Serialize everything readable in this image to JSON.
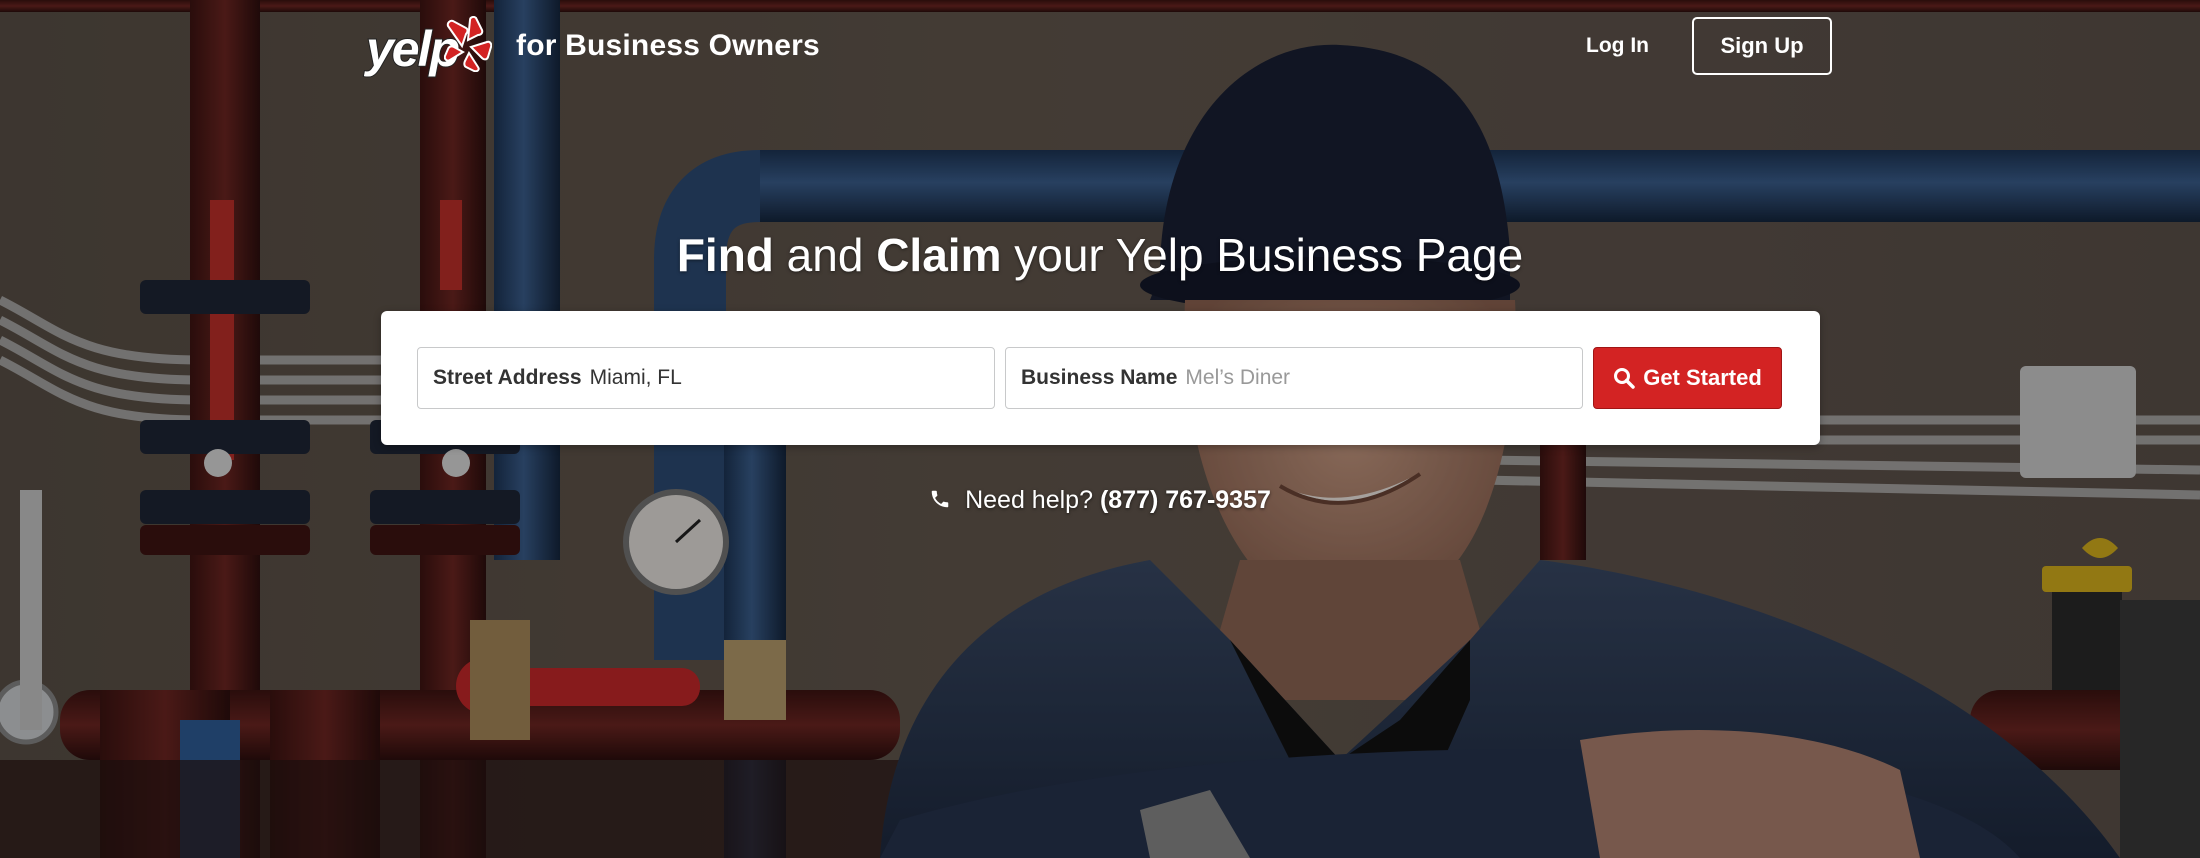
{
  "header": {
    "logo_text": "yelp",
    "tagline": "for Business Owners",
    "login_label": "Log In",
    "signup_label": "Sign Up"
  },
  "hero": {
    "headline_find": "Find",
    "headline_and": " and ",
    "headline_claim": "Claim",
    "headline_rest": " your Yelp Business Page"
  },
  "search": {
    "address_label": "Street Address",
    "address_value": "Miami, FL",
    "name_label": "Business Name",
    "name_placeholder": "Mel’s Diner",
    "button_label": "Get Started",
    "button_icon": "search-icon"
  },
  "help": {
    "icon": "phone-icon",
    "prefix": "Need help?",
    "phone": "(877) 767-9357"
  },
  "colors": {
    "brand_red": "#d32323",
    "text_white": "#ffffff"
  }
}
